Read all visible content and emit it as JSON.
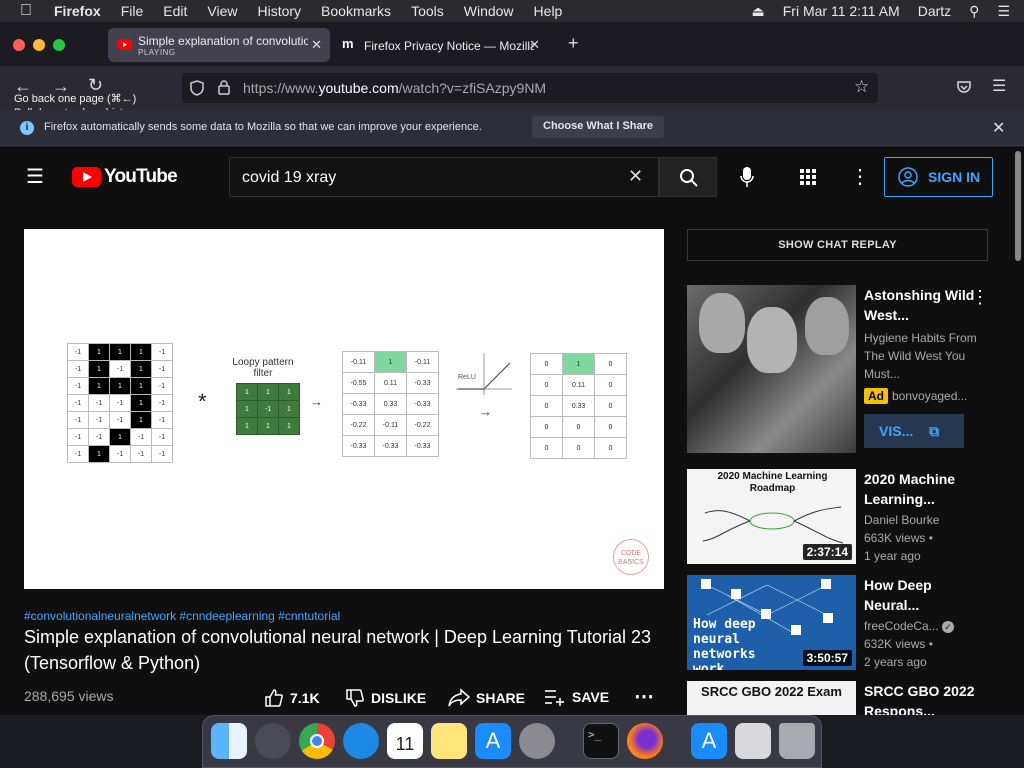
{
  "menubar": {
    "app": "Firefox",
    "items": [
      "File",
      "Edit",
      "View",
      "History",
      "Bookmarks",
      "Tools",
      "Window",
      "Help"
    ],
    "datetime": "Fri Mar 11  2:11 AM",
    "user": "Dartz"
  },
  "tabs": [
    {
      "title": "Simple explanation of convolutio",
      "status": "PLAYING"
    },
    {
      "title": "Firefox Privacy Notice — Mozilla"
    }
  ],
  "toolbar": {
    "url_prefix": "https://www.",
    "url_domain": "youtube.com",
    "url_suffix": "/watch?v=zfiSAzpy9NM",
    "tooltip_line1": "Go back one page (⌘←)",
    "tooltip_line2": "Pull down to show history"
  },
  "notice": {
    "text": "Firefox automatically sends some data to Mozilla so that we can improve your experience.",
    "button": "Choose What I Share"
  },
  "youtube": {
    "logo": "YouTube",
    "search_query": "covid 19 xray",
    "sign_in": "SIGN IN",
    "hashtags": "#convolutionalneuralnetwork #cnndeeplearning #cnntutorial",
    "video_title": "Simple explanation of convolutional neural network | Deep Learning Tutorial 23 (Tensorflow & Python)",
    "views": "288,695 views",
    "likes": "7.1K",
    "dislike": "DISLIKE",
    "share": "SHARE",
    "save": "SAVE",
    "chat_replay": "SHOW CHAT REPLAY"
  },
  "slide": {
    "filter_label": "Loopy pattern filter",
    "relu_label": "ReLU",
    "input_matrix": [
      [
        "-1",
        "1",
        "1",
        "1",
        "-1"
      ],
      [
        "-1",
        "1",
        "-1",
        "1",
        "-1"
      ],
      [
        "-1",
        "1",
        "1",
        "1",
        "-1"
      ],
      [
        "-1",
        "-1",
        "-1",
        "1",
        "-1"
      ],
      [
        "-1",
        "-1",
        "-1",
        "1",
        "-1"
      ],
      [
        "-1",
        "-1",
        "1",
        "-1",
        "-1"
      ],
      [
        "-1",
        "1",
        "-1",
        "-1",
        "-1"
      ]
    ],
    "filter_matrix": [
      [
        "1",
        "1",
        "1"
      ],
      [
        "1",
        "-1",
        "1"
      ],
      [
        "1",
        "1",
        "1"
      ]
    ],
    "feature_map": [
      [
        "-0.11",
        "1",
        "-0.11"
      ],
      [
        "-0.55",
        "0.11",
        "-0.33"
      ],
      [
        "-0.33",
        "0.33",
        "-0.33"
      ],
      [
        "-0.22",
        "-0.11",
        "-0.22"
      ],
      [
        "-0.33",
        "-0.33",
        "-0.33"
      ]
    ],
    "relu_map": [
      [
        "0",
        "1",
        "0"
      ],
      [
        "0",
        "0.11",
        "0"
      ],
      [
        "0",
        "0.33",
        "0"
      ],
      [
        "0",
        "0",
        "0"
      ],
      [
        "0",
        "0",
        "0"
      ]
    ],
    "watermark": "CODE BASICS"
  },
  "recommendations": [
    {
      "title": "Astonshing Wild West...",
      "meta1": "Hygiene Habits From The Wild West You Must...",
      "ad": "Ad",
      "channel": "bonvoyaged...",
      "cta": "VIS..."
    },
    {
      "title": "2020 Machine Learning...",
      "channel": "Daniel Bourke",
      "views": "663K views •",
      "age": "1 year ago",
      "duration": "2:37:14",
      "thumb_text": "2020 Machine Learning Roadmap"
    },
    {
      "title": "How Deep Neural...",
      "channel": "freeCodeCa...",
      "views": "632K views •",
      "age": "2 years ago",
      "duration": "3:50:57",
      "thumb_text": "How deep neural networks work"
    },
    {
      "title": "SRCC GBO 2022 Respons...",
      "thumb_text": "SRCC GBO 2022 Exam"
    }
  ],
  "colors": {
    "accent": "#3ea6ff",
    "yt_red": "#ff0000",
    "bg": "#0f0f0f",
    "highlight_green": "#7fd8a0"
  }
}
